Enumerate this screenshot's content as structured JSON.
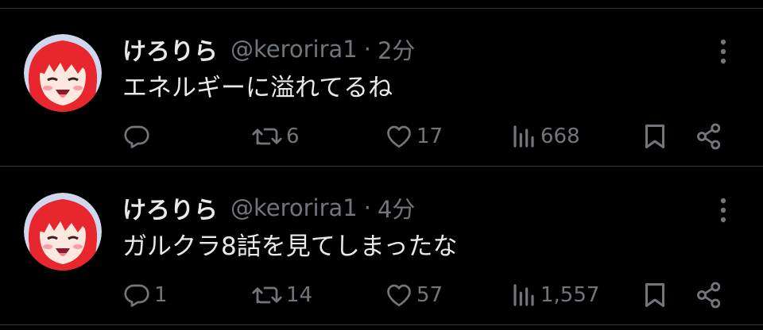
{
  "tweets": [
    {
      "name": "けろりら",
      "handle": "@kerorira1",
      "separator": "·",
      "time": "2分",
      "text": "エネルギーに溢れてるね",
      "replies": "",
      "retweets": "6",
      "likes": "17",
      "views": "668"
    },
    {
      "name": "けろりら",
      "handle": "@kerorira1",
      "separator": "·",
      "time": "4分",
      "text": "ガルクラ8話を見てしまったな",
      "replies": "1",
      "retweets": "14",
      "likes": "57",
      "views": "1,557"
    }
  ],
  "icons": {
    "reply": "reply-icon",
    "retweet": "retweet-icon",
    "like": "heart-icon",
    "views": "views-icon",
    "bookmark": "bookmark-icon",
    "share": "share-icon",
    "more": "more-icon"
  },
  "colors": {
    "background": "#000000",
    "text": "#e7e9ea",
    "muted": "#71767b",
    "divider": "#2f3336",
    "avatar_hair": "#e8262e"
  }
}
